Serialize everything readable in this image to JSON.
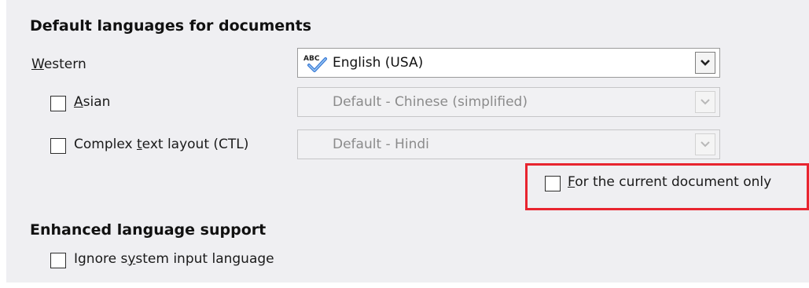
{
  "default_languages": {
    "heading": "Default languages for documents",
    "western": {
      "label_prefix": "",
      "label_mnemonic": "W",
      "label_rest": "estern",
      "value": "English (USA)"
    },
    "asian": {
      "label_prefix": "",
      "label_mnemonic": "A",
      "label_rest": "sian",
      "checked": false,
      "value": "Default - Chinese (simplified)",
      "enabled": false
    },
    "ctl": {
      "label_prefix": "Complex ",
      "label_mnemonic": "t",
      "label_rest": "ext layout (CTL)",
      "checked": false,
      "value": "Default - Hindi",
      "enabled": false
    },
    "current_doc_only": {
      "label_prefix": "",
      "label_mnemonic": "F",
      "label_rest": "or the current document only",
      "checked": false
    }
  },
  "enhanced": {
    "heading": "Enhanced language support",
    "ignore_input": {
      "label_prefix": "Ignore s",
      "label_mnemonic": "y",
      "label_rest": "stem input language",
      "checked": false
    }
  },
  "colors": {
    "highlight": "#e8242f",
    "panel": "#efeff2"
  },
  "icons": {
    "spellcheck": "abc-spellcheck-icon",
    "dropdown": "chevron-down-icon"
  }
}
